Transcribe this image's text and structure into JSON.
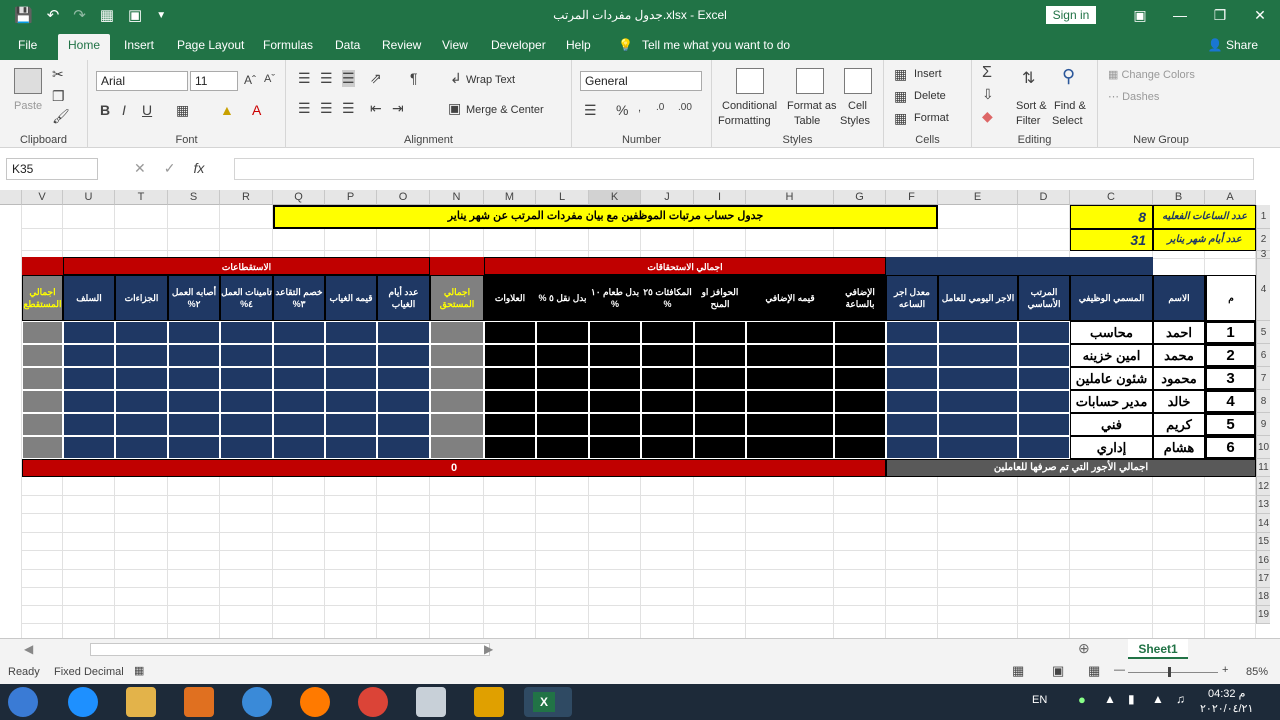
{
  "title": {
    "file": "جدول مفردات المرتب.xlsx",
    "app": "Excel",
    "full": "جدول مفردات المرتب.xlsx  -  Excel",
    "signin": "Sign in"
  },
  "tabs": [
    "File",
    "Home",
    "Insert",
    "Page Layout",
    "Formulas",
    "Data",
    "Review",
    "View",
    "Developer",
    "Help"
  ],
  "tellme": "Tell me what you want to do",
  "share": "Share",
  "ribbon": {
    "clipboard": {
      "label": "Clipboard",
      "paste": "Paste"
    },
    "font": {
      "label": "Font",
      "name": "Arial",
      "size": "11",
      "bold": "B",
      "italic": "I",
      "underline": "U"
    },
    "alignment": {
      "label": "Alignment",
      "wrap": "Wrap Text",
      "merge": "Merge & Center"
    },
    "number": {
      "label": "Number",
      "format": "General"
    },
    "styles": {
      "label": "Styles",
      "cond": "Conditional",
      "cond2": "Formatting",
      "fmt": "Format as",
      "fmt2": "Table",
      "cell": "Cell",
      "cell2": "Styles"
    },
    "cells": {
      "label": "Cells",
      "insert": "Insert",
      "delete": "Delete",
      "format": "Format"
    },
    "editing": {
      "label": "Editing",
      "sort": "Sort &",
      "sort2": "Filter",
      "find": "Find &",
      "find2": "Select"
    },
    "newgroup": {
      "label": "New Group",
      "change": "Change Colors",
      "dashes": "Dashes"
    }
  },
  "namebox": "K35",
  "columns": [
    "V",
    "U",
    "T",
    "S",
    "R",
    "Q",
    "P",
    "O",
    "N",
    "M",
    "L",
    "K",
    "J",
    "I",
    "H",
    "G",
    "F",
    "E",
    "D",
    "C",
    "B",
    "A"
  ],
  "rows": [
    "1",
    "2",
    "3",
    "4",
    "5",
    "6",
    "7",
    "8",
    "9",
    "10",
    "11",
    "12",
    "13",
    "14",
    "15",
    "16",
    "17",
    "18",
    "19"
  ],
  "sheet": {
    "main_title": "جدول حساب مرتبات الموظفين مع بيان  مفردات المرتب عن شهر يناير",
    "hours_label": "عدد الساعات الفعليه",
    "hours_value": "8",
    "days_label": "عدد أيام شهر يناير",
    "days_value": "31",
    "section_deductions": "الاستقطاعات",
    "section_entitlements": "اجمالي الاستحقاقات",
    "headers": {
      "A": "م",
      "B": "الاسم",
      "C": "المسمي الوظيفي",
      "D": "المرتب الأساسي",
      "E": "الاجر اليومي للعامل",
      "F": "معدل اجر الساعه",
      "G": "الإضافي بالساعة",
      "H": "قيمه الإضافي",
      "I": "الحوافز او المنح",
      "J": "المكافئات ٢٥ %",
      "K": "بدل طعام ١٠ %",
      "L": "بدل نقل ٥ %",
      "M": "العلاوات",
      "N": "اجمالي المستحق",
      "O": "عدد أيام الغياب",
      "P": "قيمه الغياب",
      "Q": "خصم التقاعد ٣%",
      "R": "تامينات العمل ٤%",
      "S": "أصابه العمل ٢%",
      "T": "الجزاءات",
      "U": "السلف",
      "V": "اجمالي المستقطع"
    },
    "employees": [
      {
        "num": "1",
        "name": "احمد",
        "title": "محاسب"
      },
      {
        "num": "2",
        "name": "محمد",
        "title": "امين خزينه"
      },
      {
        "num": "3",
        "name": "محمود",
        "title": "شئون عاملين"
      },
      {
        "num": "4",
        "name": "خالد",
        "title": "مدير حسابات"
      },
      {
        "num": "5",
        "name": "كريم",
        "title": "فني"
      },
      {
        "num": "6",
        "name": "هشام",
        "title": "إداري"
      }
    ],
    "total_label": "اجمالي الأجور التي تم صرفها للعاملين",
    "total_value": "0"
  },
  "sheet_tab": "Sheet1",
  "status": {
    "ready": "Ready",
    "fixed": "Fixed Decimal",
    "zoom": "85%"
  },
  "taskbar": {
    "lang": "EN",
    "time": "04:32 م",
    "date": "٢٠٢٠/٠٤/٢١"
  },
  "colors": {
    "excel_green": "#217346",
    "navy": "#1f3864",
    "black": "#000000",
    "gray": "#808080",
    "yellow": "#ffff00",
    "red": "#c00000",
    "selected": "#dbe9fb"
  }
}
